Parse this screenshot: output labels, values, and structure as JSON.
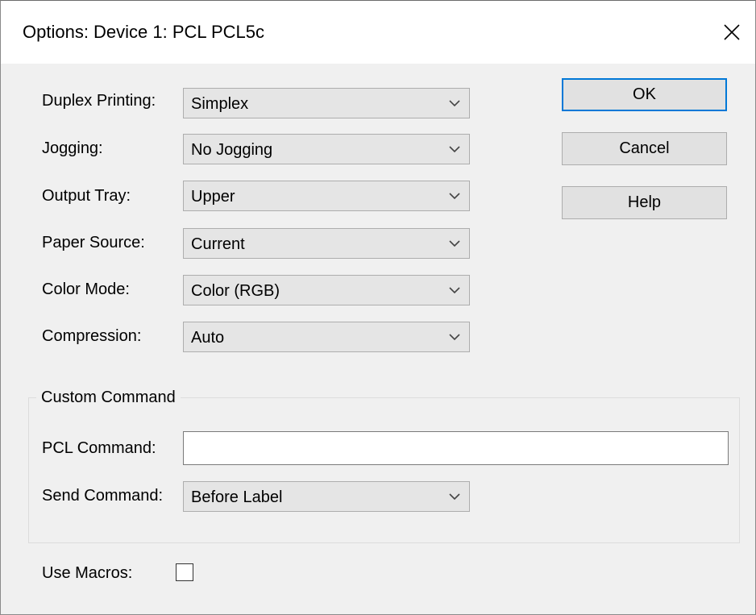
{
  "window": {
    "title": "Options: Device 1: PCL PCL5c"
  },
  "fields": [
    {
      "label": "Duplex Printing:",
      "value": "Simplex"
    },
    {
      "label": "Jogging:",
      "value": "No Jogging"
    },
    {
      "label": "Output Tray:",
      "value": "Upper"
    },
    {
      "label": "Paper Source:",
      "value": "Current"
    },
    {
      "label": "Color Mode:",
      "value": "Color (RGB)"
    },
    {
      "label": "Compression:",
      "value": "Auto"
    }
  ],
  "buttons": {
    "ok": "OK",
    "cancel": "Cancel",
    "help": "Help"
  },
  "custom_command": {
    "title": "Custom Command",
    "pcl_label": "PCL Command:",
    "pcl_value": "",
    "send_label": "Send Command:",
    "send_value": "Before Label"
  },
  "macros": {
    "label": "Use Macros:",
    "checked": false
  },
  "colors": {
    "accent": "#0078d7",
    "dialog_bg": "#f0f0f0"
  }
}
